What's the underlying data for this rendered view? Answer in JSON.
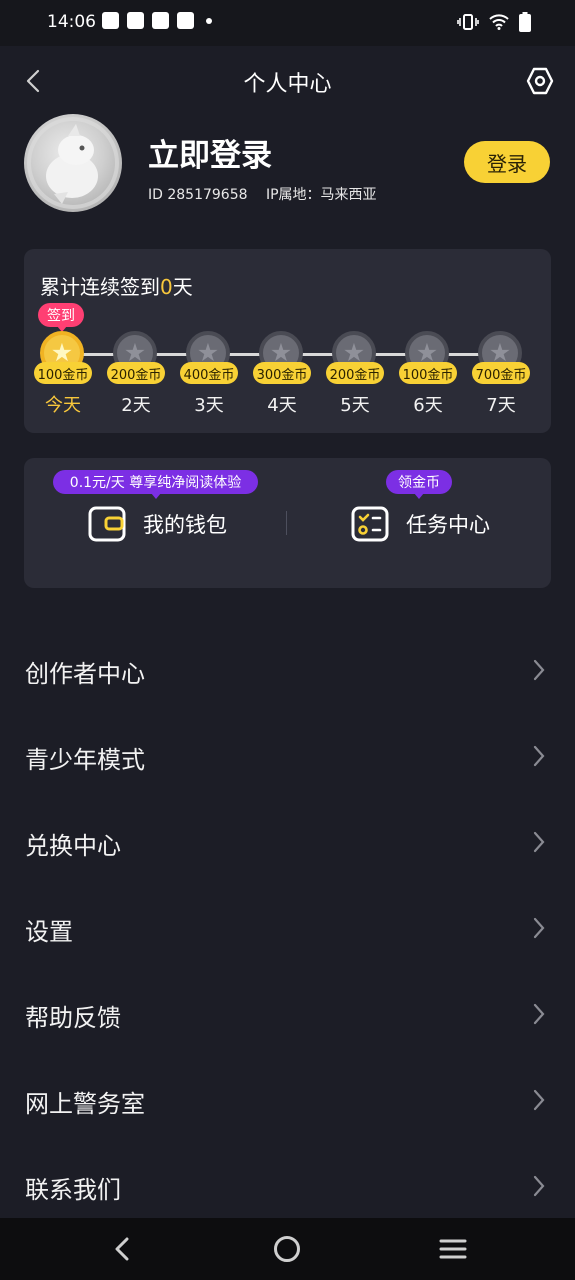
{
  "status_bar": {
    "time": "14:06"
  },
  "header": {
    "title": "个人中心",
    "back_icon": "back-chevron-icon",
    "settings_icon": "hexagon-settings-icon"
  },
  "profile": {
    "login_prompt": "立即登录",
    "user_id": "ID 285179658",
    "ip_location": "IP属地：马来西亚",
    "login_button": "登录"
  },
  "checkin": {
    "title_prefix": "累计连续签到",
    "days_count": "0",
    "title_suffix": "天",
    "sign_tag": "签到",
    "days": [
      {
        "reward": "100金币",
        "label": "今天",
        "today": true
      },
      {
        "reward": "200金币",
        "label": "2天",
        "today": false
      },
      {
        "reward": "400金币",
        "label": "3天",
        "today": false
      },
      {
        "reward": "300金币",
        "label": "4天",
        "today": false
      },
      {
        "reward": "200金币",
        "label": "5天",
        "today": false
      },
      {
        "reward": "100金币",
        "label": "6天",
        "today": false
      },
      {
        "reward": "700金币",
        "label": "7天",
        "today": false
      }
    ]
  },
  "quick_actions": {
    "wallet_promo": "0.1元/天 尊享纯净阅读体验",
    "wallet_label": "我的钱包",
    "task_promo": "领金币",
    "task_label": "任务中心"
  },
  "menu": [
    {
      "label": "创作者中心",
      "name": "menu-creator-center"
    },
    {
      "label": "青少年模式",
      "name": "menu-teen-mode"
    },
    {
      "label": "兑换中心",
      "name": "menu-exchange-center"
    },
    {
      "label": "设置",
      "name": "menu-settings"
    },
    {
      "label": "帮助反馈",
      "name": "menu-help-feedback"
    },
    {
      "label": "网上警务室",
      "name": "menu-online-police"
    },
    {
      "label": "联系我们",
      "name": "menu-contact-us"
    }
  ],
  "colors": {
    "background": "#1c1d26",
    "card": "#2b2c37",
    "accent_yellow": "#f8d135",
    "tag_pink": "#ff3f73",
    "tag_purple": "#7c2fe4"
  }
}
